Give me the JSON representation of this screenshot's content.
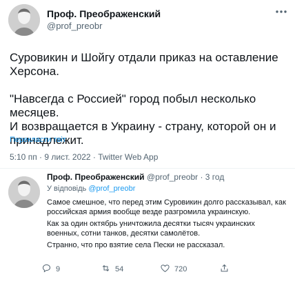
{
  "tweet": {
    "author_name": "Проф. Преображенский",
    "author_handle": "@prof_preobr",
    "more_icon": "more-dots-icon",
    "paragraphs": [
      "Суровикин и Шойгу отдали приказ на оставление Херсона.",
      "\"Навсегда с Россией\" город побыл несколько месяцев.",
      "И возвращается в Украину - страну, которой он и принадлежит."
    ],
    "translate_label": "Перекласти твіт",
    "meta": "5:10 пп · 9 лист. 2022 · Twitter Web App"
  },
  "reply": {
    "author_name": "Проф. Преображенский",
    "author_handle": "@prof_preobr",
    "time": "· 3 год",
    "replying_prefix": "У відповідь",
    "replying_handle": "@prof_preobr",
    "paragraphs": [
      "Самое смешное, что перед этим Суровикин долго рассказывал, как российская армия вообще везде разгромила украинскую.",
      "Как за один октябрь уничтожила десятки тысяч украинских военных, сотни танков, десятки самолётов.",
      "Странно, что про взятие села Пески не рассказал."
    ],
    "actions": {
      "reply_count": "9",
      "retweet_count": "54",
      "like_count": "720"
    }
  },
  "colors": {
    "text": "#0f1419",
    "secondary": "#536471",
    "link": "#1d9bf0",
    "divider": "#eff3f4"
  }
}
